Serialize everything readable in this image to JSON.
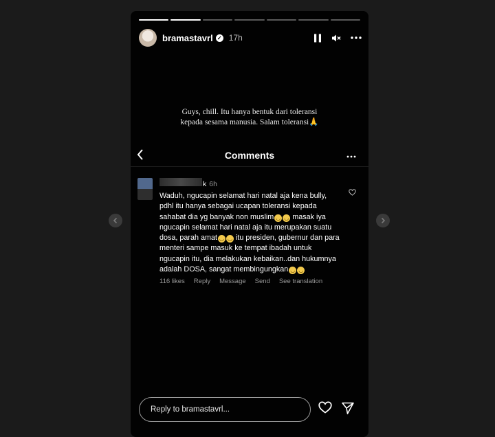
{
  "story": {
    "progress_segments": 7,
    "progress_done": 2,
    "username": "bramastavrl",
    "time": "17h",
    "caption_line1": "Guys, chill. Itu hanya bentuk dari toleransi",
    "caption_line2": "kepada sesama manusia. Salam toleransi"
  },
  "comments_panel": {
    "title": "Comments",
    "comment": {
      "username_suffix": "k",
      "time": "6h",
      "text_parts": [
        "Waduh, ngucapin selamat hari natal aja kena bully, pdhl itu hanya sebagai ucapan toleransi kepada sahabat dia yg banyak non muslim",
        " masak iya ngucapin selamat hari natal aja itu merupakan suatu dosa, parah amat",
        " itu presiden, gubernur dan para menteri sampe masuk ke tempat ibadah untuk ngucapin itu, dia melakukan kebaikan..dan hukumnya adalah DOSA, sangat membingungkan"
      ],
      "likes": "116 likes",
      "reply_label": "Reply",
      "message_label": "Message",
      "send_label": "Send",
      "translation_label": "See translation"
    }
  },
  "reply_bar": {
    "placeholder": "Reply to bramastavrl..."
  },
  "colors": {
    "background": "#1b1b1b",
    "story_bg": "#020202",
    "muted_text": "#9a9a9a"
  }
}
